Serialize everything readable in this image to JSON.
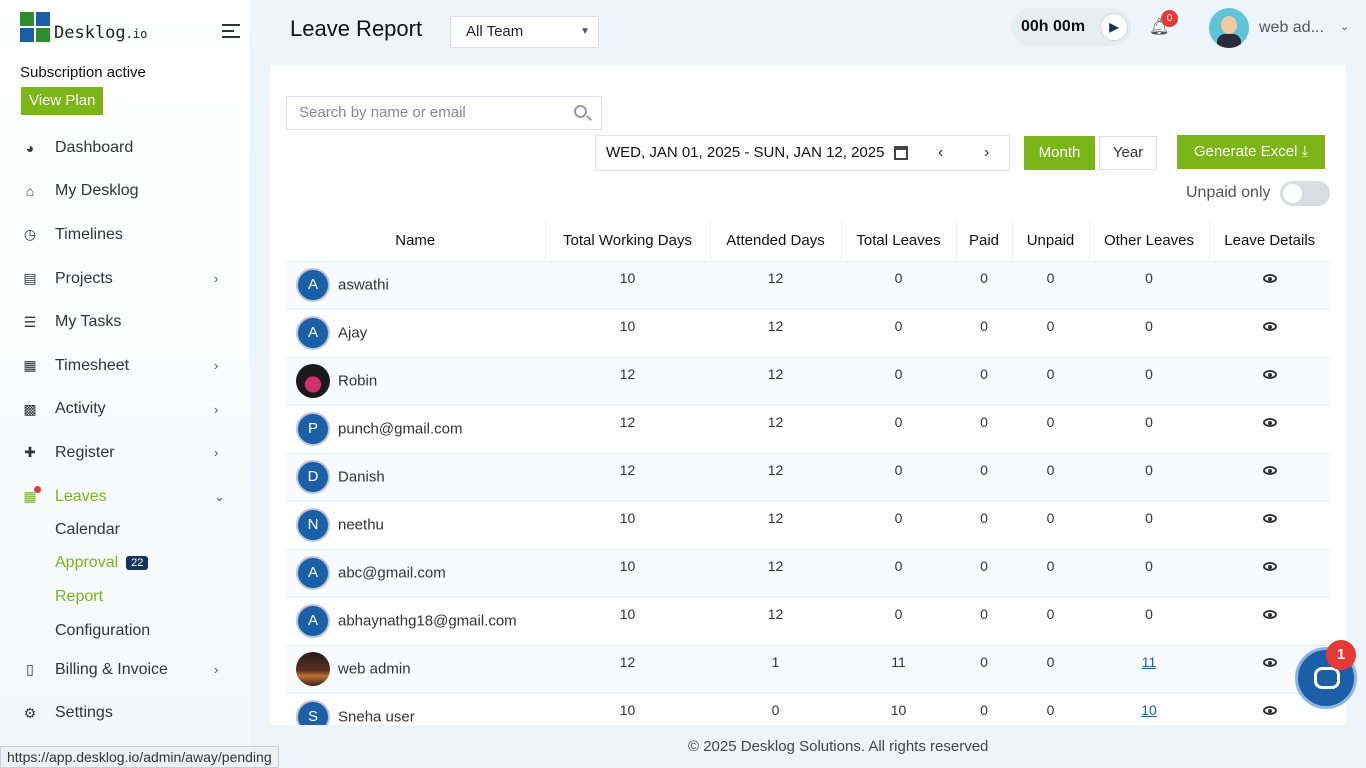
{
  "brand": {
    "name": "Desklog",
    "suffix": ".io"
  },
  "subscription": {
    "status": "Subscription active",
    "view_plan": "View Plan"
  },
  "nav": [
    {
      "label": "Dashboard",
      "icon": "dashboard-icon",
      "chevron": false
    },
    {
      "label": "My Desklog",
      "icon": "home-icon",
      "chevron": false
    },
    {
      "label": "Timelines",
      "icon": "clock-icon",
      "chevron": false
    },
    {
      "label": "Projects",
      "icon": "book-icon",
      "chevron": true
    },
    {
      "label": "My Tasks",
      "icon": "tasks-icon",
      "chevron": false
    },
    {
      "label": "Timesheet",
      "icon": "timesheet-icon",
      "chevron": true
    },
    {
      "label": "Activity",
      "icon": "grid-icon",
      "chevron": true
    },
    {
      "label": "Register",
      "icon": "plus-icon",
      "chevron": true
    },
    {
      "label": "Leaves",
      "icon": "calendar-icon",
      "chevron": true
    }
  ],
  "leaves_sub": [
    {
      "label": "Calendar"
    },
    {
      "label": "Approval",
      "badge": "22"
    },
    {
      "label": "Report"
    },
    {
      "label": "Configuration"
    }
  ],
  "nav_bottom": [
    {
      "label": "Billing & Invoice",
      "icon": "invoice-icon",
      "chevron": true
    },
    {
      "label": "Settings",
      "icon": "gear-icon",
      "chevron": false
    }
  ],
  "status_url": "https://app.desklog.io/admin/away/pending",
  "header": {
    "title": "Leave Report",
    "team_select": "All Team",
    "timer": "00h 00m",
    "notifications": "0",
    "user_name": "web ad..."
  },
  "filters": {
    "search_placeholder": "Search by name or email",
    "date_range": "WED, JAN 01, 2025 - SUN, JAN 12, 2025",
    "month": "Month",
    "year": "Year",
    "generate_excel": "Generate Excel",
    "unpaid_only": "Unpaid only"
  },
  "table": {
    "headers": [
      "Name",
      "Total Working Days",
      "Attended Days",
      "Total Leaves",
      "Paid",
      "Unpaid",
      "Other Leaves",
      "Leave Details"
    ],
    "rows": [
      {
        "initial": "A",
        "name": "aswathi",
        "working": "10",
        "attended": "12",
        "leaves": "0",
        "paid": "0",
        "unpaid": "0",
        "other": "0"
      },
      {
        "initial": "A",
        "name": "Ajay",
        "working": "10",
        "attended": "12",
        "leaves": "0",
        "paid": "0",
        "unpaid": "0",
        "other": "0"
      },
      {
        "initial": "",
        "name": "Robin",
        "working": "12",
        "attended": "12",
        "leaves": "0",
        "paid": "0",
        "unpaid": "0",
        "other": "0"
      },
      {
        "initial": "P",
        "name": "punch@gmail.com",
        "working": "12",
        "attended": "12",
        "leaves": "0",
        "paid": "0",
        "unpaid": "0",
        "other": "0"
      },
      {
        "initial": "D",
        "name": "Danish",
        "working": "12",
        "attended": "12",
        "leaves": "0",
        "paid": "0",
        "unpaid": "0",
        "other": "0"
      },
      {
        "initial": "N",
        "name": "neethu",
        "working": "10",
        "attended": "12",
        "leaves": "0",
        "paid": "0",
        "unpaid": "0",
        "other": "0"
      },
      {
        "initial": "A",
        "name": "abc@gmail.com",
        "working": "10",
        "attended": "12",
        "leaves": "0",
        "paid": "0",
        "unpaid": "0",
        "other": "0"
      },
      {
        "initial": "A",
        "name": "abhaynathg18@gmail.com",
        "working": "10",
        "attended": "12",
        "leaves": "0",
        "paid": "0",
        "unpaid": "0",
        "other": "0"
      },
      {
        "initial": "",
        "name": "web admin",
        "working": "12",
        "attended": "1",
        "leaves": "11",
        "paid": "0",
        "unpaid": "0",
        "other": "11"
      },
      {
        "initial": "S",
        "name": "Sneha user",
        "working": "10",
        "attended": "0",
        "leaves": "10",
        "paid": "0",
        "unpaid": "0",
        "other": "10"
      }
    ]
  },
  "footer": "© 2025 Desklog Solutions. All rights reserved",
  "chat": {
    "badge": "1"
  },
  "colors": {
    "accent": "#7cb518",
    "navy": "#16335a",
    "avatar": "#1b5fa8",
    "alert": "#e53935"
  }
}
